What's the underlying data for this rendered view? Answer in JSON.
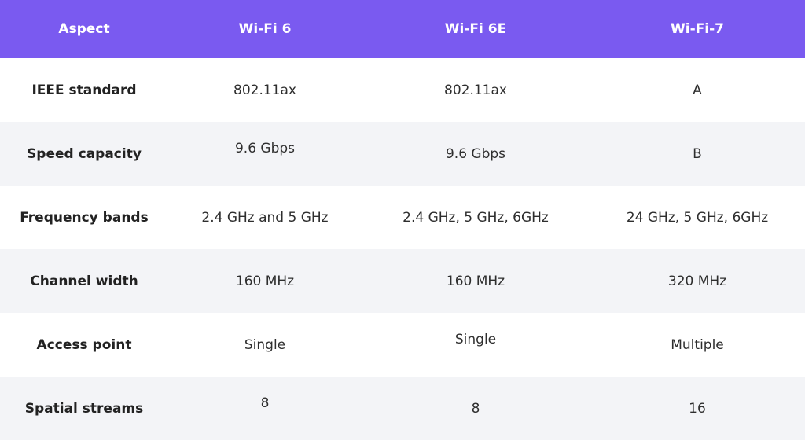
{
  "colors": {
    "header_bg": "#7a5af0",
    "alt_row_bg": "#f3f4f7"
  },
  "headers": [
    "Aspect",
    "Wi-Fi 6",
    "Wi-Fi 6E",
    "Wi-Fi-7"
  ],
  "rows": [
    [
      "IEEE standard",
      "802.11ax",
      "802.11ax",
      "A"
    ],
    [
      "Speed capacity",
      "9.6 Gbps",
      "9.6 Gbps",
      "B"
    ],
    [
      "Frequency bands",
      "2.4 GHz and 5 GHz",
      "2.4 GHz, 5 GHz, 6GHz",
      "24 GHz, 5 GHz, 6GHz"
    ],
    [
      "Channel width",
      "160 MHz",
      "160 MHz",
      "320 MHz"
    ],
    [
      "Access point",
      "Single",
      "Single",
      "Multiple"
    ],
    [
      "Spatial streams",
      "8",
      "8",
      "16"
    ]
  ]
}
